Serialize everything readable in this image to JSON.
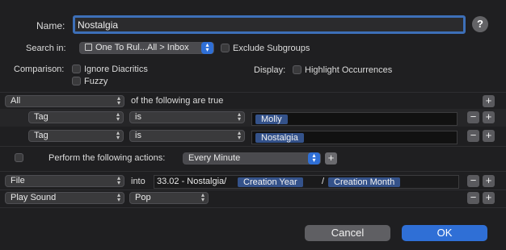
{
  "name_label": "Name:",
  "name_value": "Nostalgia",
  "help_glyph": "?",
  "search_in_label": "Search in:",
  "search_in_value": "One To Rul...All > Inbox",
  "exclude_subgroups": "Exclude Subgroups",
  "comparison_label": "Comparison:",
  "ignore_diacritics": "Ignore Diacritics",
  "fuzzy": "Fuzzy",
  "display_label": "Display:",
  "highlight_occurrences": "Highlight Occurrences",
  "match_mode": "All",
  "of_following": "of the following are true",
  "criteria": [
    {
      "field": "Tag",
      "operator": "is",
      "token": "Molly"
    },
    {
      "field": "Tag",
      "operator": "is",
      "token": "Nostalgia"
    }
  ],
  "perform_label": "Perform the following actions:",
  "perform_schedule": "Every Minute",
  "actions": {
    "file": {
      "action": "File",
      "into": "into",
      "path_prefix": "33.02 - Nostalgia/",
      "token1": "Creation Year",
      "separator": "/",
      "token2": "Creation Month"
    },
    "sound": {
      "action": "Play Sound",
      "value": "Pop"
    }
  },
  "plus": "+",
  "minus": "−",
  "cancel": "Cancel",
  "ok": "OK",
  "colors": {
    "accent": "#2f6fd6",
    "token": "#34528a",
    "background": "#1f1f21"
  }
}
